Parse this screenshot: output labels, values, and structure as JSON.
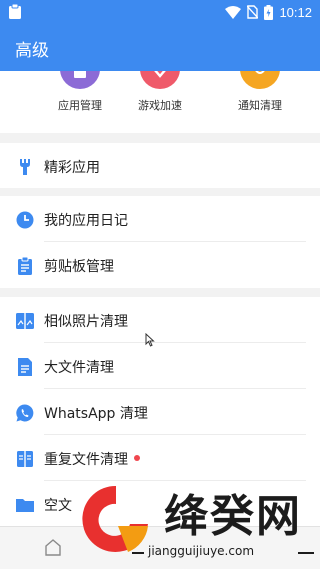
{
  "status_bar": {
    "time": "10:12"
  },
  "app_bar": {
    "title": "高级"
  },
  "tools": [
    {
      "label": "应用管理",
      "color": "#8c6bd6",
      "icon": "app-manage-icon"
    },
    {
      "label": "游戏加速",
      "color": "#ef5a6a",
      "icon": "game-boost-icon"
    },
    {
      "label": "通知清理",
      "color": "#f5a623",
      "icon": "notification-clean-icon"
    }
  ],
  "sections": {
    "featured": {
      "label": "精彩应用",
      "icon": "wrench-icon"
    },
    "diary": {
      "label": "我的应用日记",
      "icon": "clock-icon"
    },
    "clipboard": {
      "label": "剪贴板管理",
      "icon": "clipboard-icon"
    },
    "similar_photos": {
      "label": "相似照片清理",
      "icon": "photo-compare-icon"
    },
    "large_files": {
      "label": "大文件清理",
      "icon": "document-icon"
    },
    "whatsapp": {
      "label": "WhatsApp 清理",
      "icon": "whatsapp-icon"
    },
    "duplicate_files": {
      "label": "重复文件清理",
      "icon": "duplicate-file-icon",
      "badge": "new"
    },
    "empty_folders": {
      "label": "空文",
      "icon": "folder-icon"
    }
  },
  "accent_color": "#3d8af0",
  "watermark": {
    "text": "绛癸网",
    "url": "jiangguijiuye.com"
  }
}
